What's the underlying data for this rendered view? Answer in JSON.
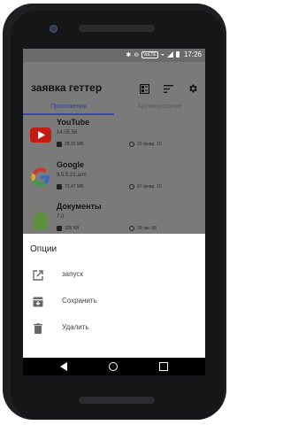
{
  "status": {
    "time": "17:26",
    "network_badge": "VoLTE"
  },
  "appbar": {
    "title": "заявка геттер"
  },
  "tabs": [
    {
      "label": "Приложения"
    },
    {
      "label": "Архивирование"
    }
  ],
  "apps": [
    {
      "name": "YouTube",
      "version": "14.05.56",
      "size": "28,92 MB",
      "date": "25 февр. 19",
      "icon": "youtube-icon"
    },
    {
      "name": "Google",
      "version": "9.5.5.21.arm",
      "size": "72,47 MB",
      "date": "07 февр. 19",
      "icon": "google-icon"
    },
    {
      "name": "Документы",
      "version": "7.0",
      "size": "326 KB",
      "date": "29 авг. 08",
      "icon": "android-icon"
    }
  ],
  "sheet": {
    "title": "Опции",
    "items": [
      {
        "label": "запуск",
        "icon": "launch-icon"
      },
      {
        "label": "Сохранить",
        "icon": "save-icon"
      },
      {
        "label": "Удалить",
        "icon": "delete-icon"
      }
    ]
  },
  "colors": {
    "accent": "#3949ab",
    "youtube_red": "#e62117",
    "android_green": "#78b84a"
  }
}
